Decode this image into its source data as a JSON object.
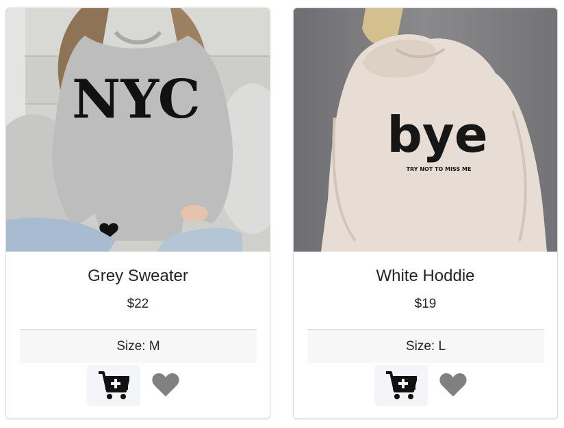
{
  "products": [
    {
      "title": "Grey Sweater",
      "price": "$22",
      "size": "Size: M",
      "image_icon": "grey-nyc-sweatshirt-photo",
      "image_text": "NYC"
    },
    {
      "title": "White Hoddie",
      "price": "$19",
      "size": "Size: L",
      "image_icon": "white-bye-hoodie-photo",
      "image_text": "bye",
      "image_subtext": "TRY NOT TO MISS ME"
    }
  ],
  "colors": {
    "card_border": "#d9d9d9",
    "size_bg": "#f7f7f7",
    "cart_bg": "#f3f5f8",
    "icon": "#111111",
    "heart": "#808080"
  },
  "icons": {
    "cart": "add-to-cart-icon",
    "heart": "heart-icon"
  }
}
